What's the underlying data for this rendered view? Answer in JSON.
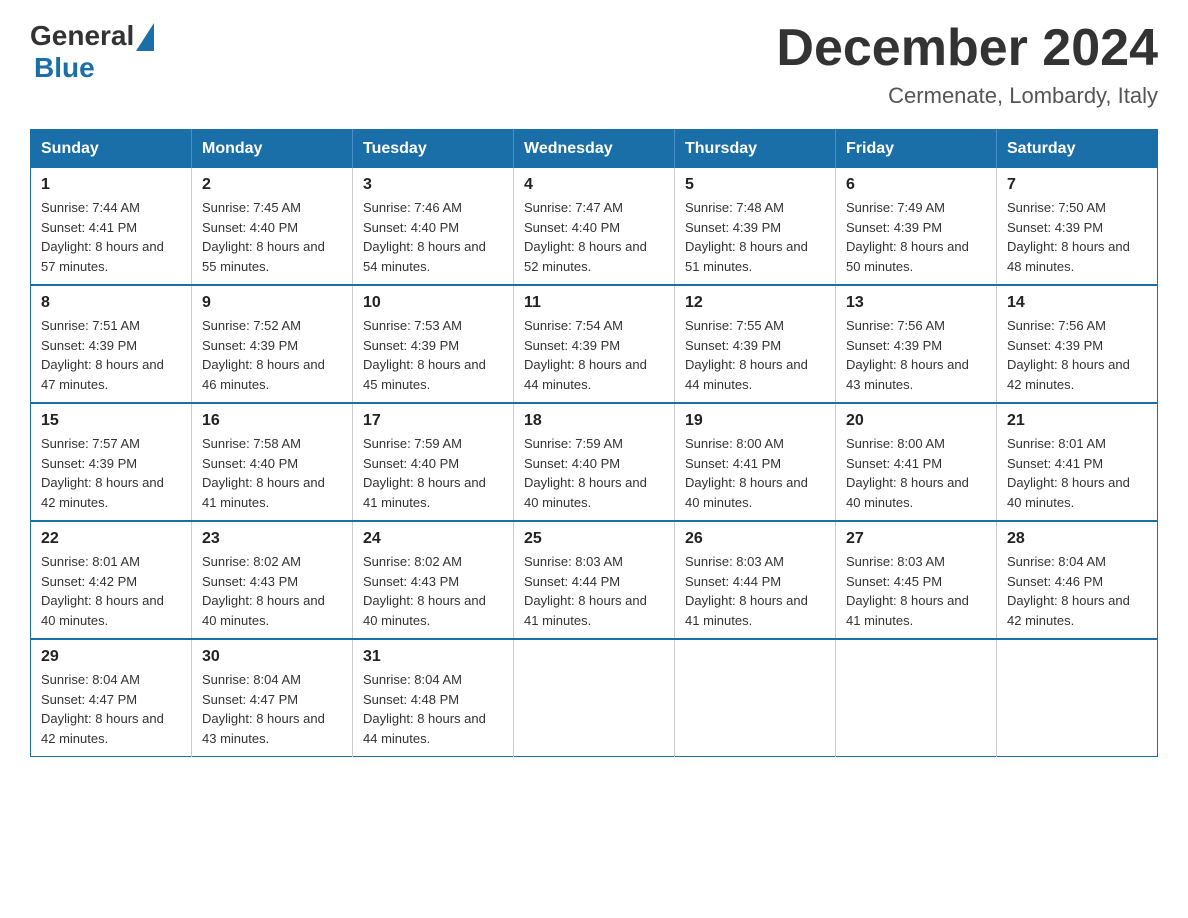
{
  "logo": {
    "general": "General",
    "blue": "Blue"
  },
  "title": {
    "month": "December 2024",
    "location": "Cermenate, Lombardy, Italy"
  },
  "days_of_week": [
    "Sunday",
    "Monday",
    "Tuesday",
    "Wednesday",
    "Thursday",
    "Friday",
    "Saturday"
  ],
  "weeks": [
    [
      {
        "day": "1",
        "sunrise": "7:44 AM",
        "sunset": "4:41 PM",
        "daylight": "8 hours and 57 minutes."
      },
      {
        "day": "2",
        "sunrise": "7:45 AM",
        "sunset": "4:40 PM",
        "daylight": "8 hours and 55 minutes."
      },
      {
        "day": "3",
        "sunrise": "7:46 AM",
        "sunset": "4:40 PM",
        "daylight": "8 hours and 54 minutes."
      },
      {
        "day": "4",
        "sunrise": "7:47 AM",
        "sunset": "4:40 PM",
        "daylight": "8 hours and 52 minutes."
      },
      {
        "day": "5",
        "sunrise": "7:48 AM",
        "sunset": "4:39 PM",
        "daylight": "8 hours and 51 minutes."
      },
      {
        "day": "6",
        "sunrise": "7:49 AM",
        "sunset": "4:39 PM",
        "daylight": "8 hours and 50 minutes."
      },
      {
        "day": "7",
        "sunrise": "7:50 AM",
        "sunset": "4:39 PM",
        "daylight": "8 hours and 48 minutes."
      }
    ],
    [
      {
        "day": "8",
        "sunrise": "7:51 AM",
        "sunset": "4:39 PM",
        "daylight": "8 hours and 47 minutes."
      },
      {
        "day": "9",
        "sunrise": "7:52 AM",
        "sunset": "4:39 PM",
        "daylight": "8 hours and 46 minutes."
      },
      {
        "day": "10",
        "sunrise": "7:53 AM",
        "sunset": "4:39 PM",
        "daylight": "8 hours and 45 minutes."
      },
      {
        "day": "11",
        "sunrise": "7:54 AM",
        "sunset": "4:39 PM",
        "daylight": "8 hours and 44 minutes."
      },
      {
        "day": "12",
        "sunrise": "7:55 AM",
        "sunset": "4:39 PM",
        "daylight": "8 hours and 44 minutes."
      },
      {
        "day": "13",
        "sunrise": "7:56 AM",
        "sunset": "4:39 PM",
        "daylight": "8 hours and 43 minutes."
      },
      {
        "day": "14",
        "sunrise": "7:56 AM",
        "sunset": "4:39 PM",
        "daylight": "8 hours and 42 minutes."
      }
    ],
    [
      {
        "day": "15",
        "sunrise": "7:57 AM",
        "sunset": "4:39 PM",
        "daylight": "8 hours and 42 minutes."
      },
      {
        "day": "16",
        "sunrise": "7:58 AM",
        "sunset": "4:40 PM",
        "daylight": "8 hours and 41 minutes."
      },
      {
        "day": "17",
        "sunrise": "7:59 AM",
        "sunset": "4:40 PM",
        "daylight": "8 hours and 41 minutes."
      },
      {
        "day": "18",
        "sunrise": "7:59 AM",
        "sunset": "4:40 PM",
        "daylight": "8 hours and 40 minutes."
      },
      {
        "day": "19",
        "sunrise": "8:00 AM",
        "sunset": "4:41 PM",
        "daylight": "8 hours and 40 minutes."
      },
      {
        "day": "20",
        "sunrise": "8:00 AM",
        "sunset": "4:41 PM",
        "daylight": "8 hours and 40 minutes."
      },
      {
        "day": "21",
        "sunrise": "8:01 AM",
        "sunset": "4:41 PM",
        "daylight": "8 hours and 40 minutes."
      }
    ],
    [
      {
        "day": "22",
        "sunrise": "8:01 AM",
        "sunset": "4:42 PM",
        "daylight": "8 hours and 40 minutes."
      },
      {
        "day": "23",
        "sunrise": "8:02 AM",
        "sunset": "4:43 PM",
        "daylight": "8 hours and 40 minutes."
      },
      {
        "day": "24",
        "sunrise": "8:02 AM",
        "sunset": "4:43 PM",
        "daylight": "8 hours and 40 minutes."
      },
      {
        "day": "25",
        "sunrise": "8:03 AM",
        "sunset": "4:44 PM",
        "daylight": "8 hours and 41 minutes."
      },
      {
        "day": "26",
        "sunrise": "8:03 AM",
        "sunset": "4:44 PM",
        "daylight": "8 hours and 41 minutes."
      },
      {
        "day": "27",
        "sunrise": "8:03 AM",
        "sunset": "4:45 PM",
        "daylight": "8 hours and 41 minutes."
      },
      {
        "day": "28",
        "sunrise": "8:04 AM",
        "sunset": "4:46 PM",
        "daylight": "8 hours and 42 minutes."
      }
    ],
    [
      {
        "day": "29",
        "sunrise": "8:04 AM",
        "sunset": "4:47 PM",
        "daylight": "8 hours and 42 minutes."
      },
      {
        "day": "30",
        "sunrise": "8:04 AM",
        "sunset": "4:47 PM",
        "daylight": "8 hours and 43 minutes."
      },
      {
        "day": "31",
        "sunrise": "8:04 AM",
        "sunset": "4:48 PM",
        "daylight": "8 hours and 44 minutes."
      },
      null,
      null,
      null,
      null
    ]
  ]
}
